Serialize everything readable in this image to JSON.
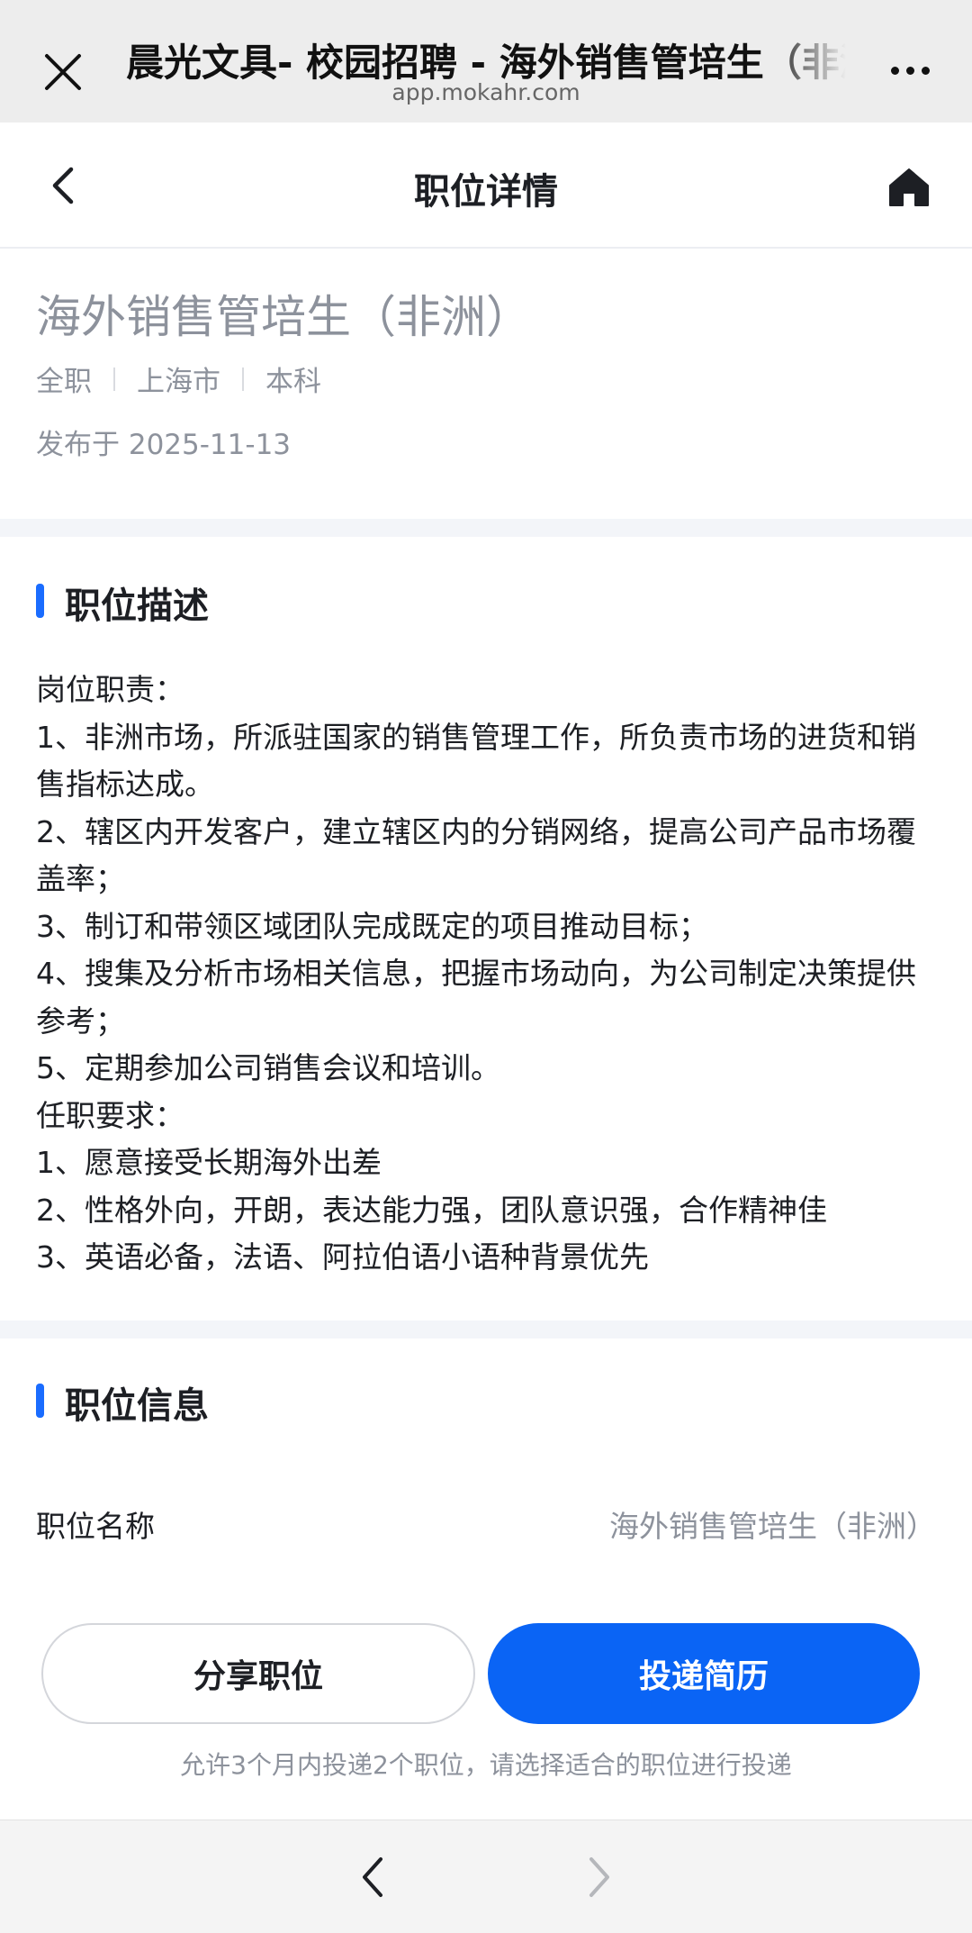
{
  "browser": {
    "title": "晨光文具- 校园招聘 - 海外销售管培生（非洲）",
    "url": "app.mokahr.com",
    "close_icon": "close-icon",
    "more_icon": "more-icon"
  },
  "nav": {
    "title": "职位详情",
    "back_icon": "chevron-left-icon",
    "home_icon": "home-icon"
  },
  "job": {
    "title": "海外销售管培生（非洲）",
    "tags": [
      "全职",
      "上海市",
      "本科"
    ],
    "published": "发布于 2025-11-13"
  },
  "description": {
    "section_title": "职位描述",
    "lines": [
      "岗位职责：",
      "1、非洲市场，所派驻国家的销售管理工作，所负责市场的进货和销售指标达成。",
      "2、辖区内开发客户，建立辖区内的分销网络，提高公司产品市场覆盖率；",
      "3、制订和带领区域团队完成既定的项目推动目标；",
      "4、搜集及分析市场相关信息，把握市场动向，为公司制定决策提供参考；",
      "5、定期参加公司销售会议和培训。",
      "任职要求：",
      "1、愿意接受长期海外出差",
      "2、性格外向，开朗，表达能力强，团队意识强，合作精神佳",
      "3、英语必备，法语、阿拉伯语小语种背景优先"
    ]
  },
  "info": {
    "section_title": "职位信息",
    "rows": [
      {
        "label": "职位名称",
        "value": "海外销售管培生（非洲）"
      }
    ]
  },
  "actions": {
    "share_label": "分享职位",
    "apply_label": "投递简历",
    "note": "允许3个月内投递2个职位，请选择适合的职位进行投递"
  },
  "colors": {
    "accent": "#0a64f5",
    "section_bar": "#1a6cff",
    "muted_text": "#8d929c"
  },
  "browser_bottom": {
    "back_icon": "chevron-left-icon",
    "forward_icon": "chevron-right-icon"
  }
}
